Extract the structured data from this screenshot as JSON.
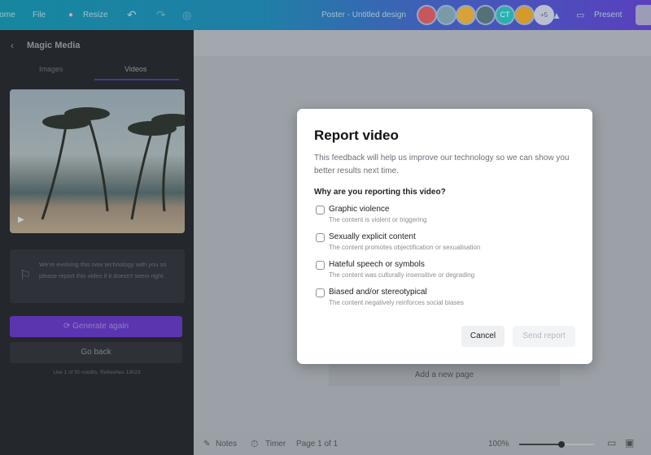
{
  "topbar": {
    "home": "Home",
    "file": "File",
    "resize": "Resize",
    "title": "Poster - Untitled design",
    "more_collaborators": "+5",
    "avatar_initials": "CT",
    "present": "Present",
    "colors": [
      "#c9565b",
      "#7a9aa8",
      "#d7a23a",
      "#56707a",
      "#2ab0b0",
      "#d49a2a"
    ]
  },
  "sidebar": {
    "title": "Magic Media",
    "tabs": [
      {
        "label": "Images"
      },
      {
        "label": "Videos",
        "active": true
      }
    ],
    "notice": "We're evolving this new technology with you so please report this video if it doesn't seem right.",
    "generate_label": "Generate again",
    "back_label": "Go back",
    "credits": "Use 1 of 50 credits. Refreshes 1/8/23",
    "accent": "#6a3fc8"
  },
  "canvas": {
    "add_page": "Add a new page"
  },
  "bottombar": {
    "notes": "Notes",
    "timer": "Timer",
    "page": "Page 1 of 1",
    "zoom": "100%",
    "zoom_level": 0.55
  },
  "modal": {
    "title": "Report video",
    "description": "This feedback will help us improve our technology so we can show you better results next time.",
    "question": "Why are you reporting this video?",
    "options": [
      {
        "label": "Graphic violence",
        "sub": "The content is violent or triggering",
        "checked": false
      },
      {
        "label": "Sexually explicit content",
        "sub": "The content promotes objectification or sexualisation",
        "checked": false
      },
      {
        "label": "Hateful speech or symbols",
        "sub": "The content was culturally insensitive or degrading",
        "checked": false
      },
      {
        "label": "Biased and/or stereotypical",
        "sub": "The content negatively reinforces social biases",
        "checked": false
      }
    ],
    "cancel": "Cancel",
    "send": "Send report"
  }
}
